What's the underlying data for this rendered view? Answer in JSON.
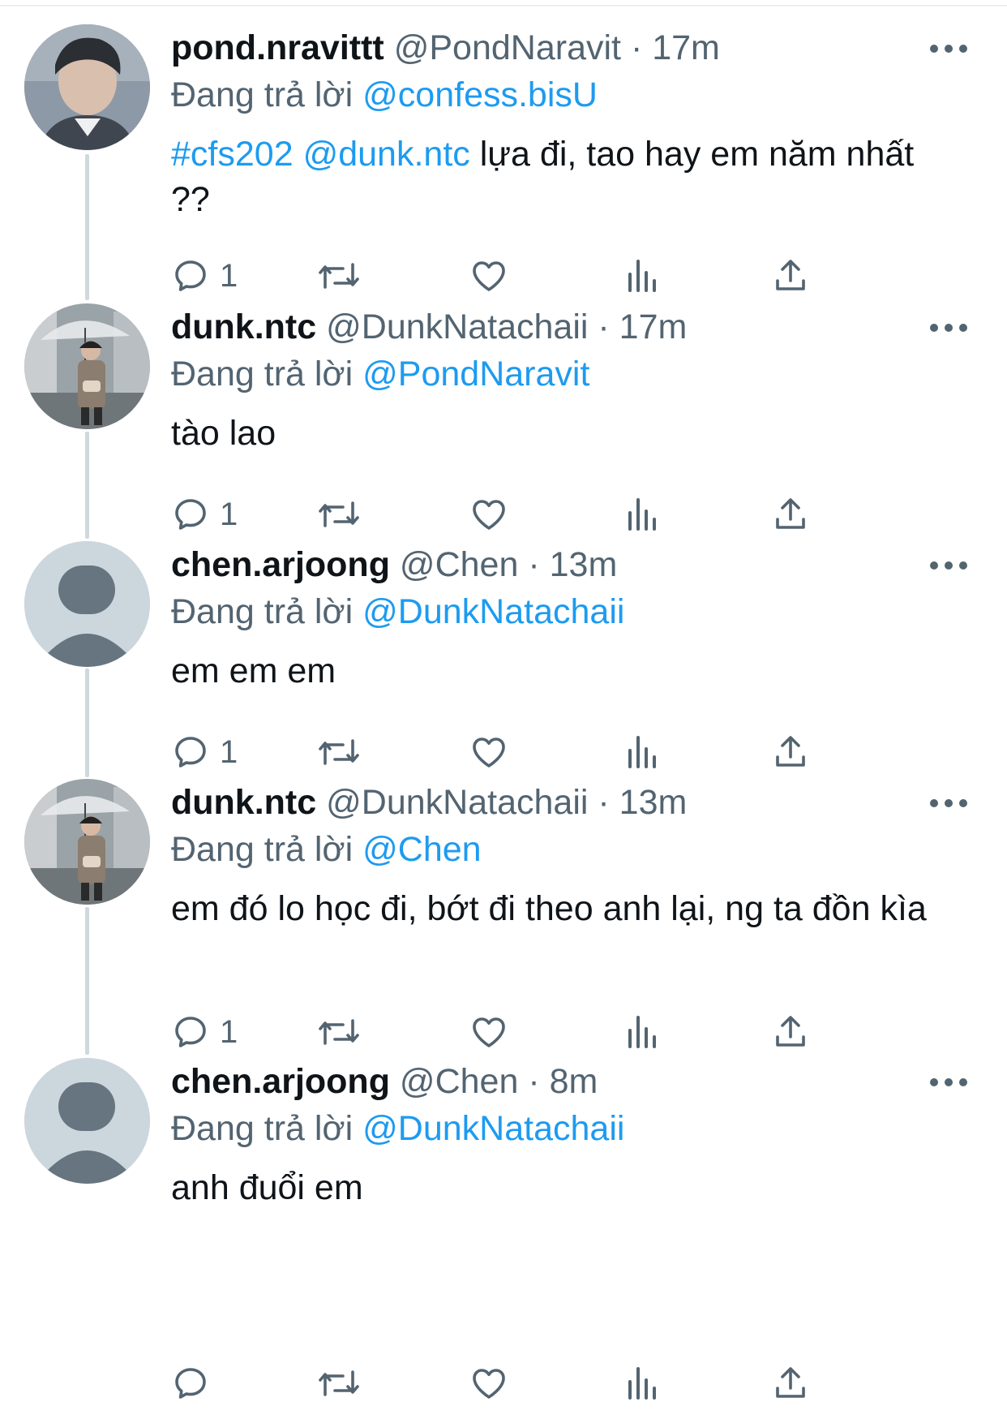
{
  "colors": {
    "accent": "#1d9bf0",
    "text": "#0f1419",
    "muted": "#536471",
    "thread": "#cfd9de"
  },
  "replying_prefix": "Đang trả lời",
  "separator": "·",
  "tweets": [
    {
      "name": "pond.nravittt",
      "handle": "@PondNaravit",
      "time": "17m",
      "reply_to": "@confess.bisU",
      "tag": "#cfs202",
      "mention": "@dunk.ntc",
      "text": "lựa đi, tao hay em năm nhất ??",
      "reply_count": "1",
      "avatar": "photo-avatar"
    },
    {
      "name": "dunk.ntc",
      "handle": "@DunkNatachaii",
      "time": "17m",
      "reply_to": "@PondNaravit",
      "text": "tào lao",
      "reply_count": "1",
      "avatar": "photo-avatar"
    },
    {
      "name": "chen.arjoong",
      "handle": "@Chen",
      "time": "13m",
      "reply_to": "@DunkNatachaii",
      "text": "em em em",
      "reply_count": "1",
      "avatar": "default-avatar"
    },
    {
      "name": "dunk.ntc",
      "handle": "@DunkNatachaii",
      "time": "13m",
      "reply_to": "@Chen",
      "text": "em đó lo học đi, bớt đi theo anh lại, ng ta đồn kìa",
      "reply_count": "1",
      "avatar": "photo-avatar"
    },
    {
      "name": "chen.arjoong",
      "handle": "@Chen",
      "time": "8m",
      "reply_to": "@DunkNatachaii",
      "text": "anh đuổi em",
      "reply_count": "",
      "avatar": "default-avatar"
    }
  ],
  "icons": [
    "reply-icon",
    "retweet-icon",
    "like-icon",
    "views-icon",
    "share-icon",
    "more-icon"
  ]
}
